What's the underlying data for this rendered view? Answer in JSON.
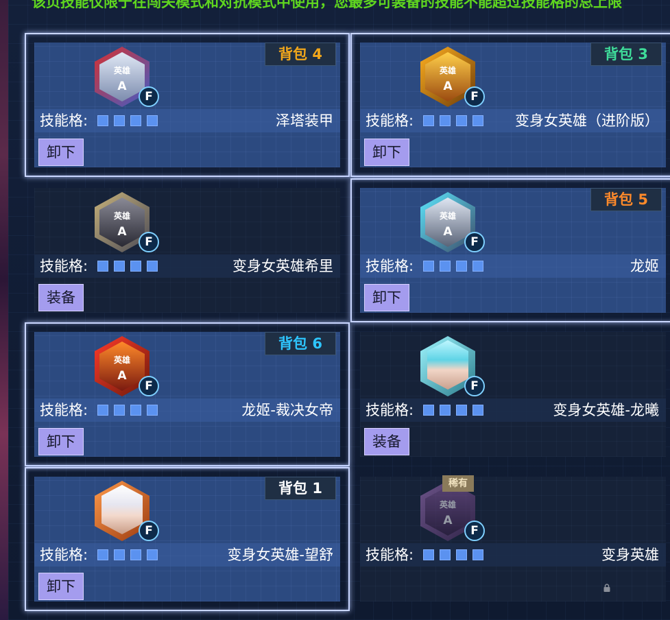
{
  "notice": "该页技能仅限于在闯关模式和对抗模式中使用，您最多可装备的技能不能超过技能格的总上限",
  "slot_label": "技能格:",
  "colors": {
    "equipped_border": "#c9d6ff",
    "button_bg": "#a49cee",
    "slot_color": "#5b92f0",
    "notice_color": "#5fd61f"
  },
  "cards": [
    {
      "name": "泽塔装甲",
      "bag": "背包 4",
      "bag_color": "#f2a71b",
      "action": "卸下",
      "equipped": true,
      "icon": "hero-emblem-red-blue-icon",
      "icon_label": "英雄",
      "rank": "A",
      "badge": "F"
    },
    {
      "name": "变身女英雄（进阶版）",
      "bag": "背包 3",
      "bag_color": "#3fdc9a",
      "action": "卸下",
      "equipped": true,
      "icon": "hero-emblem-gold-icon",
      "icon_label": "英雄",
      "rank": "A",
      "badge": "F"
    },
    {
      "name": "变身女英雄希里",
      "bag": "",
      "action": "装备",
      "equipped": false,
      "icon": "hero-emblem-silver-gold-icon",
      "icon_label": "英雄",
      "rank": "A",
      "badge": "F"
    },
    {
      "name": "龙姬",
      "bag": "背包 5",
      "bag_color": "#ff8a2a",
      "action": "卸下",
      "equipped": true,
      "icon": "hero-emblem-cyan-silver-icon",
      "icon_label": "英雄",
      "rank": "A",
      "badge": "F"
    },
    {
      "name": "龙姬-裁决女帝",
      "bag": "背包 6",
      "bag_color": "#2ec6ff",
      "action": "卸下",
      "equipped": true,
      "icon": "hero-emblem-red-orange-icon",
      "icon_label": "英雄",
      "rank": "A",
      "badge": "F"
    },
    {
      "name": "变身女英雄-龙曦",
      "bag": "",
      "action": "装备",
      "equipped": false,
      "icon": "heroine-portrait-cyan-hair-icon",
      "icon_label": "",
      "rank": "",
      "badge": "F"
    },
    {
      "name": "变身女英雄-望舒",
      "bag": "背包 1",
      "bag_color": "#ffffff",
      "action": "卸下",
      "equipped": true,
      "icon": "heroine-portrait-white-hair-icon",
      "icon_label": "",
      "rank": "",
      "badge": "F"
    },
    {
      "name": "变身英雄",
      "bag": "",
      "action": "",
      "equipped": false,
      "locked": true,
      "rare": "稀有",
      "icon": "hero-emblem-purple-faded-icon",
      "icon_label": "英雄",
      "rank": "A",
      "badge": "F"
    }
  ]
}
